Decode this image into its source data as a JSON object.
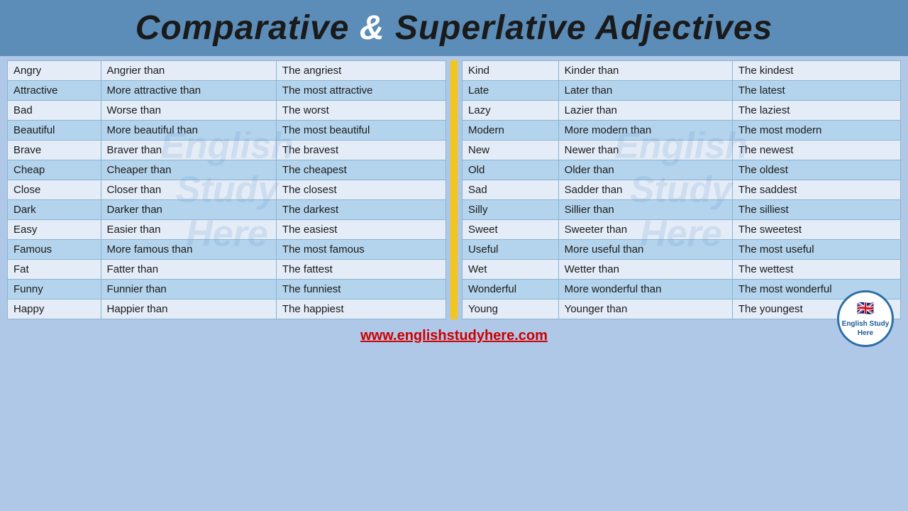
{
  "header": {
    "title_part1": "Comparative",
    "ampersand": "&",
    "title_part2": "Superlative Adjectives"
  },
  "left_table": {
    "rows": [
      [
        "Angry",
        "Angrier than",
        "The angriest"
      ],
      [
        "Attractive",
        "More attractive than",
        "The most attractive"
      ],
      [
        "Bad",
        "Worse than",
        "The worst"
      ],
      [
        "Beautiful",
        "More beautiful than",
        "The  most beautiful"
      ],
      [
        "Brave",
        "Braver than",
        "The bravest"
      ],
      [
        "Cheap",
        "Cheaper than",
        "The cheapest"
      ],
      [
        "Close",
        "Closer than",
        "The closest"
      ],
      [
        "Dark",
        "Darker than",
        "The darkest"
      ],
      [
        "Easy",
        "Easier than",
        "The easiest"
      ],
      [
        "Famous",
        "More famous than",
        "The most famous"
      ],
      [
        "Fat",
        "Fatter than",
        "The fattest"
      ],
      [
        "Funny",
        "Funnier than",
        "The funniest"
      ],
      [
        "Happy",
        "Happier than",
        "The happiest"
      ]
    ]
  },
  "right_table": {
    "rows": [
      [
        "Kind",
        "Kinder than",
        "The kindest"
      ],
      [
        "Late",
        "Later than",
        "The latest"
      ],
      [
        "Lazy",
        "Lazier than",
        "The laziest"
      ],
      [
        "Modern",
        "More modern than",
        "The most modern"
      ],
      [
        "New",
        "Newer than",
        "The newest"
      ],
      [
        "Old",
        "Older than",
        "The oldest"
      ],
      [
        "Sad",
        "Sadder than",
        "The saddest"
      ],
      [
        "Silly",
        "Sillier than",
        "The silliest"
      ],
      [
        "Sweet",
        "Sweeter than",
        "The sweetest"
      ],
      [
        "Useful",
        "More useful than",
        "The most useful"
      ],
      [
        "Wet",
        "Wetter than",
        "The wettest"
      ],
      [
        "Wonderful",
        "More wonderful than",
        "The most wonderful"
      ],
      [
        "Young",
        "Younger than",
        "The youngest"
      ]
    ]
  },
  "footer": {
    "url": "www.englishstudyhere.com",
    "url_full": "www.englishstudyhere.com"
  },
  "logo": {
    "text": "English Study Here"
  }
}
